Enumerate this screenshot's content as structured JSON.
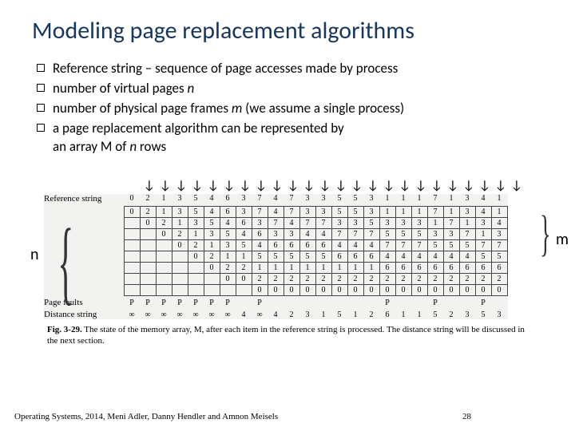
{
  "title": "Modeling page replacement algorithms",
  "bullets": [
    "Reference string – sequence of page accesses made by process",
    "number of virtual pages <i>n</i>",
    "number of physical page frames <i>m</i> (we assume a single process)",
    "a page replacement algorithm can be represented by<br>an array M of <i>n</i> rows"
  ],
  "labels": {
    "n": "n",
    "m": "m"
  },
  "fig": {
    "ref_label": "Reference string",
    "ref": [
      "0",
      "2",
      "1",
      "3",
      "5",
      "4",
      "6",
      "3",
      "7",
      "4",
      "7",
      "3",
      "3",
      "5",
      "5",
      "3",
      "1",
      "1",
      "1",
      "7",
      "1",
      "3",
      "4",
      "1"
    ],
    "matrix": [
      [
        "0",
        "2",
        "1",
        "3",
        "5",
        "4",
        "6",
        "3",
        "7",
        "4",
        "7",
        "3",
        "3",
        "5",
        "5",
        "3",
        "1",
        "1",
        "1",
        "7",
        "1",
        "3",
        "4",
        "1"
      ],
      [
        "",
        "0",
        "2",
        "1",
        "3",
        "5",
        "4",
        "6",
        "3",
        "7",
        "4",
        "7",
        "7",
        "3",
        "3",
        "5",
        "3",
        "3",
        "3",
        "1",
        "7",
        "1",
        "3",
        "4"
      ],
      [
        "",
        "",
        "0",
        "2",
        "1",
        "3",
        "5",
        "4",
        "6",
        "3",
        "3",
        "4",
        "4",
        "7",
        "7",
        "7",
        "5",
        "5",
        "5",
        "3",
        "3",
        "7",
        "1",
        "3"
      ],
      [
        "",
        "",
        "",
        "0",
        "2",
        "1",
        "3",
        "5",
        "4",
        "6",
        "6",
        "6",
        "6",
        "4",
        "4",
        "4",
        "7",
        "7",
        "7",
        "5",
        "5",
        "5",
        "7",
        "7"
      ],
      [
        "",
        "",
        "",
        "",
        "0",
        "2",
        "1",
        "1",
        "5",
        "5",
        "5",
        "5",
        "5",
        "6",
        "6",
        "6",
        "4",
        "4",
        "4",
        "4",
        "4",
        "4",
        "5",
        "5"
      ],
      [
        "",
        "",
        "",
        "",
        "",
        "0",
        "2",
        "2",
        "1",
        "1",
        "1",
        "1",
        "1",
        "1",
        "1",
        "1",
        "6",
        "6",
        "6",
        "6",
        "6",
        "6",
        "6",
        "6"
      ],
      [
        "",
        "",
        "",
        "",
        "",
        "",
        "0",
        "0",
        "2",
        "2",
        "2",
        "2",
        "2",
        "2",
        "2",
        "2",
        "2",
        "2",
        "2",
        "2",
        "2",
        "2",
        "2",
        "2"
      ],
      [
        "",
        "",
        "",
        "",
        "",
        "",
        "",
        "",
        "0",
        "0",
        "0",
        "0",
        "0",
        "0",
        "0",
        "0",
        "0",
        "0",
        "0",
        "0",
        "0",
        "0",
        "0",
        "0"
      ]
    ],
    "fault_label": "Page faults",
    "faults": [
      "P",
      "P",
      "P",
      "P",
      "P",
      "P",
      "P",
      "",
      "P",
      "",
      "",
      "",
      "",
      "",
      "",
      "",
      "P",
      "",
      "",
      "P",
      "",
      "",
      "P",
      ""
    ],
    "dist_label": "Distance string",
    "dist": [
      "∞",
      "∞",
      "∞",
      "∞",
      "∞",
      "∞",
      "∞",
      "4",
      "∞",
      "4",
      "2",
      "3",
      "1",
      "5",
      "1",
      "2",
      "6",
      "1",
      "1",
      "5",
      "2",
      "3",
      "5",
      "3"
    ],
    "caption_strong": "Fig. 3-29.",
    "caption_rest": " The state of the memory array, M, after each item in the reference string is processed. The distance string will be discussed in the next section."
  },
  "footer": "Operating Systems, 2014, Meni Adler, Danny Hendler and Amnon Meisels",
  "page": "28"
}
